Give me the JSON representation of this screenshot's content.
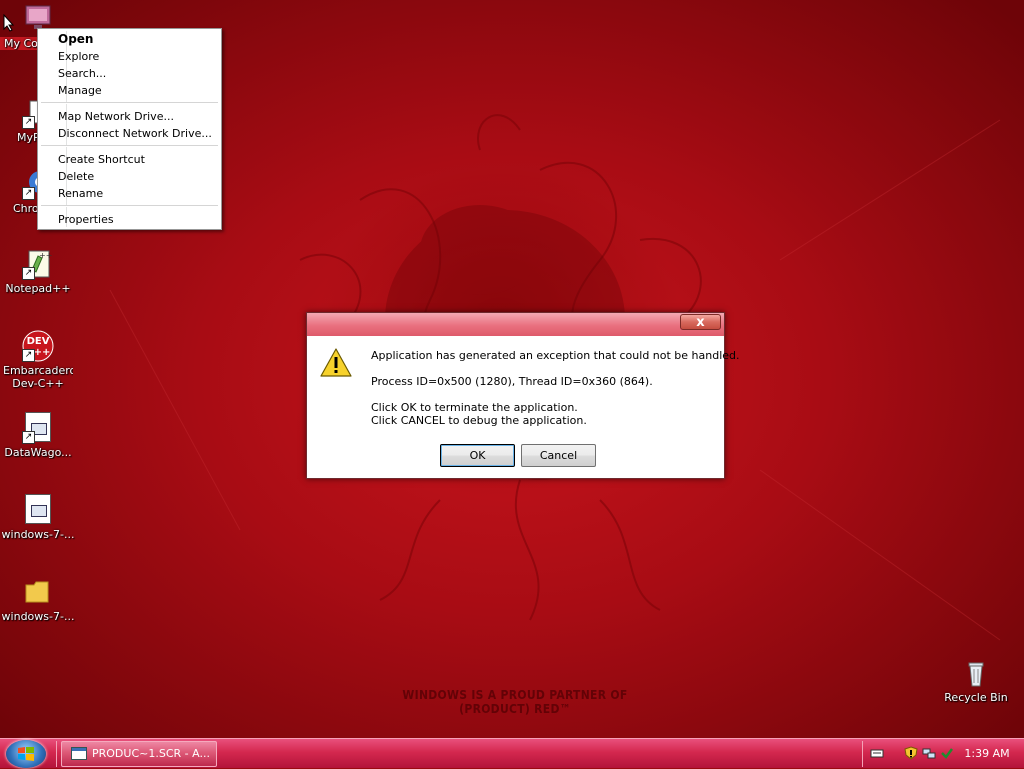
{
  "desktop": {
    "watermark": "WINDOWS IS A PROUD PARTNER OF (PRODUCT) RED™",
    "icons": [
      {
        "label": "My Computer",
        "icon": "computer-icon"
      },
      {
        "label": "My Documents",
        "icon": "documents-icon"
      },
      {
        "label": "Chrome",
        "icon": "chrome-icon"
      },
      {
        "label": "Notepad++",
        "icon": "notepad-plus-plus-icon"
      },
      {
        "label": "Embarcadero Dev-C++",
        "icon": "devcpp-icon"
      },
      {
        "label": "DataWago...",
        "icon": "file-icon"
      },
      {
        "label": "windows-7-...",
        "icon": "file-icon"
      },
      {
        "label": "windows-7-...",
        "icon": "folder-icon"
      },
      {
        "label": "Recycle Bin",
        "icon": "recycle-bin-icon"
      }
    ],
    "icon_visible_labels": [
      "My Co",
      "MyP",
      "Chro"
    ],
    "devcpp_icon_text": "DEV",
    "devcpp_icon_text2": "++"
  },
  "context_menu": {
    "items": [
      {
        "label": "Open",
        "bold": true
      },
      {
        "label": "Explore"
      },
      {
        "label": "Search..."
      },
      {
        "label": "Manage"
      },
      {
        "label": "Map Network Drive..."
      },
      {
        "label": "Disconnect Network Drive..."
      },
      {
        "label": "Create Shortcut"
      },
      {
        "label": "Delete"
      },
      {
        "label": "Rename"
      },
      {
        "label": "Properties"
      }
    ]
  },
  "dialog": {
    "title": "",
    "close_label": "x",
    "message_1": "Application has generated an exception that could not be handled.",
    "message_2": "Process ID=0x500 (1280), Thread ID=0x360 (864).",
    "message_3": "Click OK to terminate the application.",
    "message_4": "Click CANCEL to debug the application.",
    "ok_label": "OK",
    "cancel_label": "Cancel",
    "icon": "warning-icon"
  },
  "taskbar": {
    "start_icon": "windows-start-orb-icon",
    "task_items": [
      {
        "label": "PRODUC~1.SCR - A..."
      }
    ],
    "tray_icons": [
      "keyboard-icon",
      "security-shield-icon",
      "network-icon",
      "update-icon"
    ],
    "clock": "1:39 AM"
  },
  "colors": {
    "desktop_red": "#b30f17",
    "taskbar_pink": "#d4284f",
    "dialog_titlebar": "#e9707f"
  }
}
